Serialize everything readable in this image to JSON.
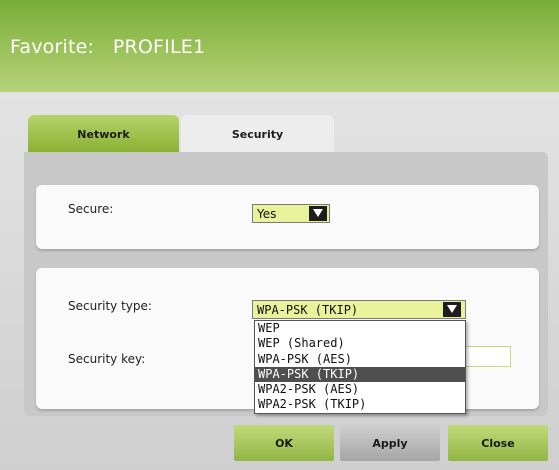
{
  "window": {
    "title": "Favorite:   PROFILE1"
  },
  "tabs": [
    {
      "label": "Network",
      "active": false
    },
    {
      "label": "Security",
      "active": true
    }
  ],
  "secure": {
    "label": "Secure:",
    "value": "Yes"
  },
  "security_type": {
    "label": "Security type:",
    "value": "WPA-PSK (TKIP)",
    "options": [
      "WEP",
      "WEP (Shared)",
      "WPA-PSK (AES)",
      "WPA-PSK (TKIP)",
      "WPA2-PSK (AES)",
      "WPA2-PSK (TKIP)"
    ],
    "selected_option": "WPA-PSK (TKIP)"
  },
  "security_key": {
    "label": "Security key:",
    "value": ""
  },
  "buttons": {
    "ok": "OK",
    "apply": "Apply",
    "close": "Close"
  },
  "colors": {
    "accent_green": "#9cc25a",
    "select_fill": "#e7f29a",
    "selected_option": "#4f4f4f"
  },
  "icons": {
    "dropdown_arrow": "chevron-down-icon"
  }
}
